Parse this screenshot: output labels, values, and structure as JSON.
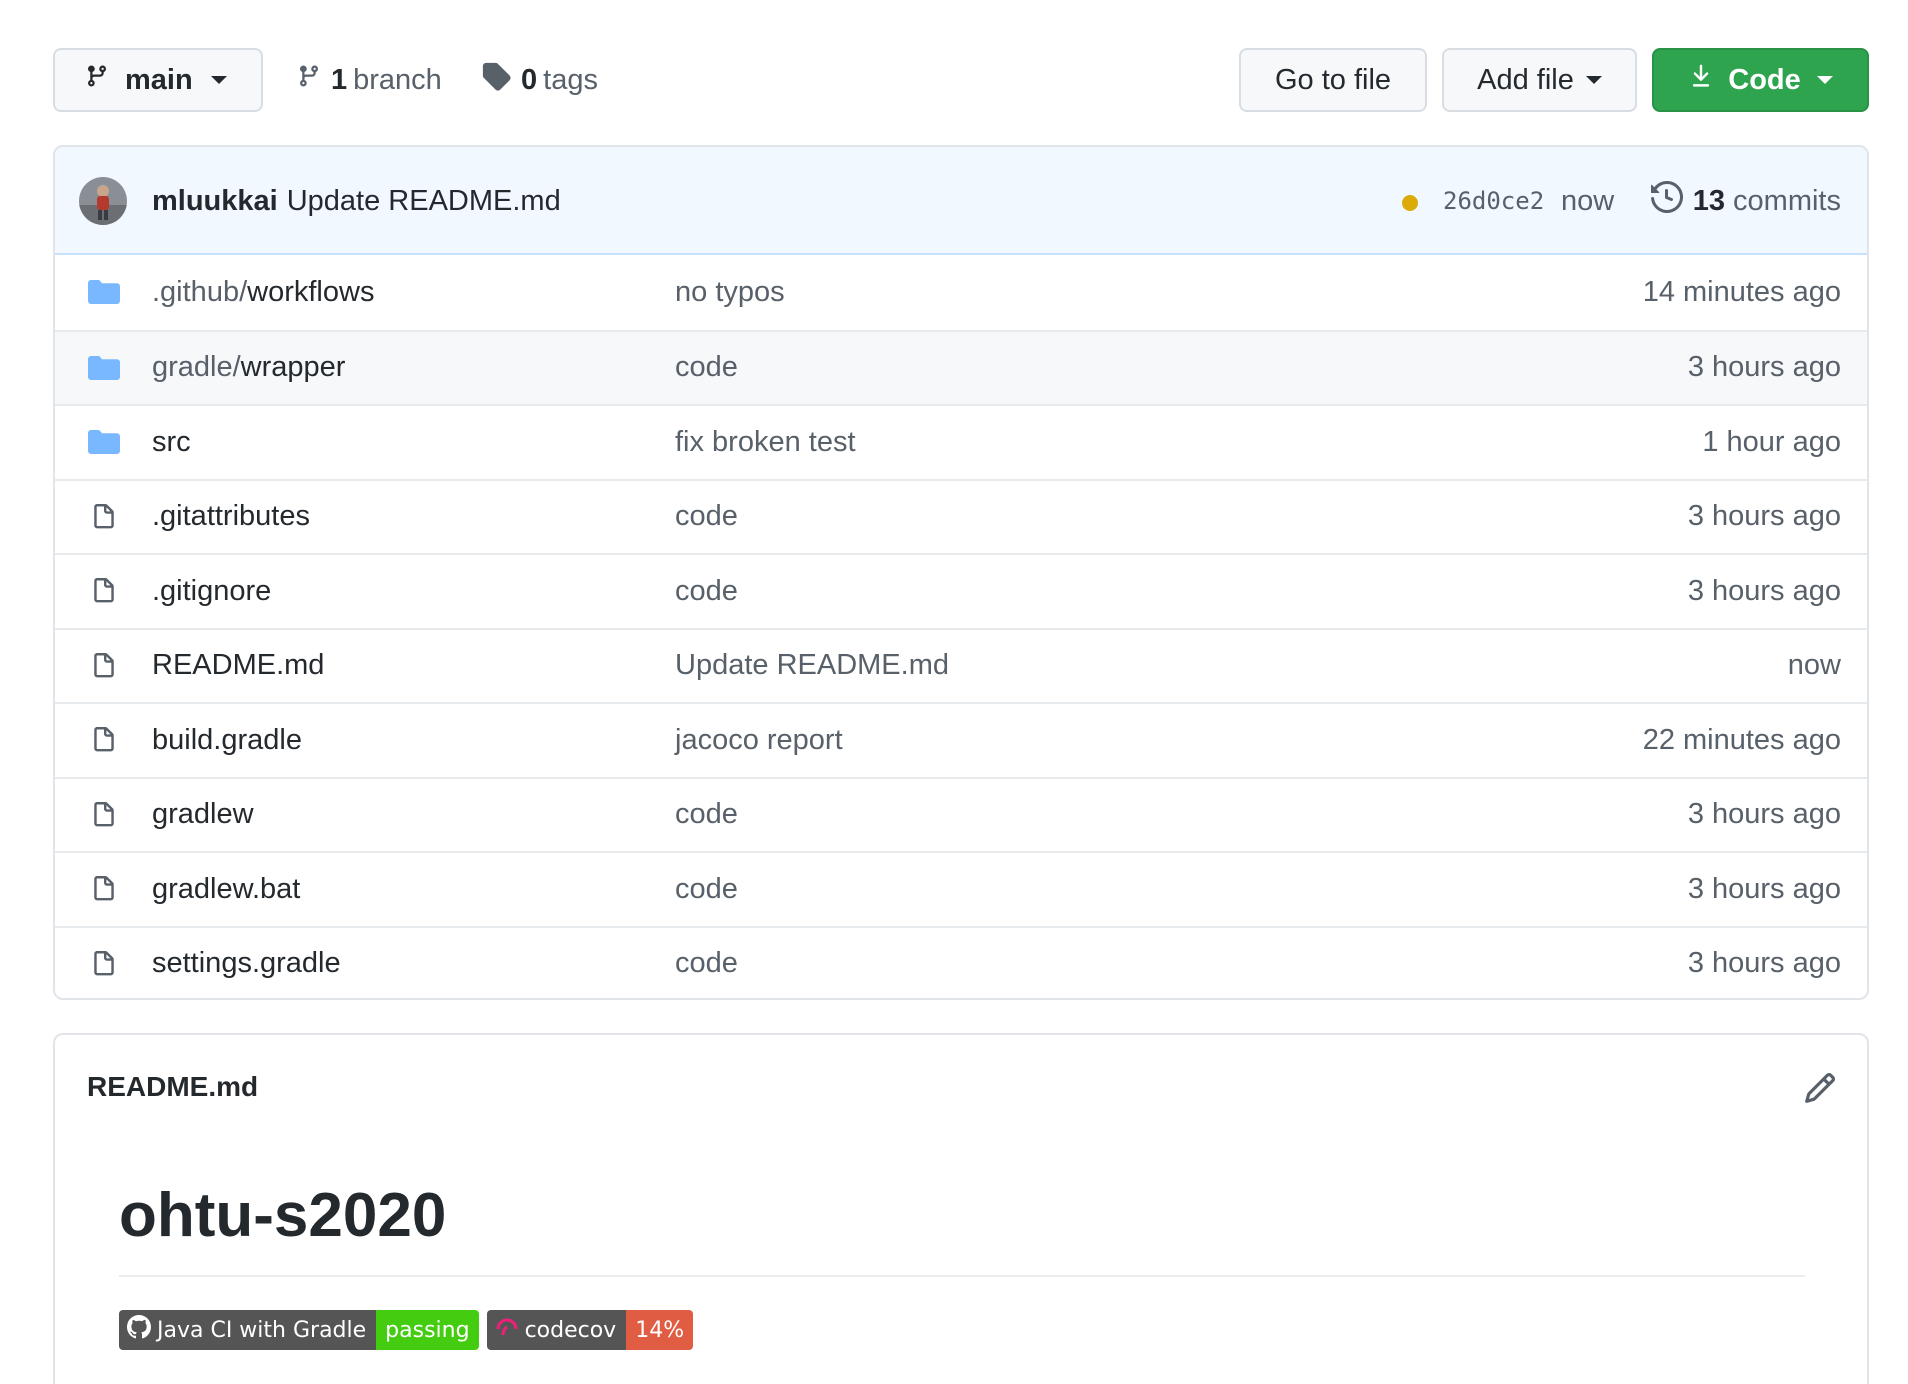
{
  "toolbar": {
    "branch_label": "main",
    "branch_count": "1",
    "branch_word": "branch",
    "tag_count": "0",
    "tag_word": "tags",
    "go_to_file": "Go to file",
    "add_file": "Add file",
    "code": "Code"
  },
  "commit": {
    "author": "mluukkai",
    "message": "Update README.md",
    "sha": "26d0ce2",
    "time": "now",
    "commit_count": "13",
    "commit_word": "commits",
    "status_color": "#dbab09"
  },
  "files": [
    {
      "type": "folder",
      "prefix": ".github/",
      "name": "workflows",
      "message": "no typos",
      "age": "14 minutes ago"
    },
    {
      "type": "folder",
      "prefix": "gradle/",
      "name": "wrapper",
      "message": "code",
      "age": "3 hours ago"
    },
    {
      "type": "folder",
      "prefix": "",
      "name": "src",
      "message": "fix broken test",
      "age": "1 hour ago"
    },
    {
      "type": "file",
      "prefix": "",
      "name": ".gitattributes",
      "message": "code",
      "age": "3 hours ago"
    },
    {
      "type": "file",
      "prefix": "",
      "name": ".gitignore",
      "message": "code",
      "age": "3 hours ago"
    },
    {
      "type": "file",
      "prefix": "",
      "name": "README.md",
      "message": "Update README.md",
      "age": "now"
    },
    {
      "type": "file",
      "prefix": "",
      "name": "build.gradle",
      "message": "jacoco report",
      "age": "22 minutes ago"
    },
    {
      "type": "file",
      "prefix": "",
      "name": "gradlew",
      "message": "code",
      "age": "3 hours ago"
    },
    {
      "type": "file",
      "prefix": "",
      "name": "gradlew.bat",
      "message": "code",
      "age": "3 hours ago"
    },
    {
      "type": "file",
      "prefix": "",
      "name": "settings.gradle",
      "message": "code",
      "age": "3 hours ago"
    }
  ],
  "readme": {
    "filename": "README.md",
    "heading": "ohtu-s2020",
    "badges": [
      {
        "label": "Java CI with Gradle",
        "value": "passing",
        "color": "#44cc11",
        "icon": "github-icon"
      },
      {
        "label": "codecov",
        "value": "14%",
        "color": "#e05d44",
        "icon": "codecov-icon"
      }
    ]
  },
  "colors": {
    "primary_button": "#2ea44f",
    "folder_icon": "#79b8ff",
    "commit_bar_bg": "#f1f8ff"
  }
}
